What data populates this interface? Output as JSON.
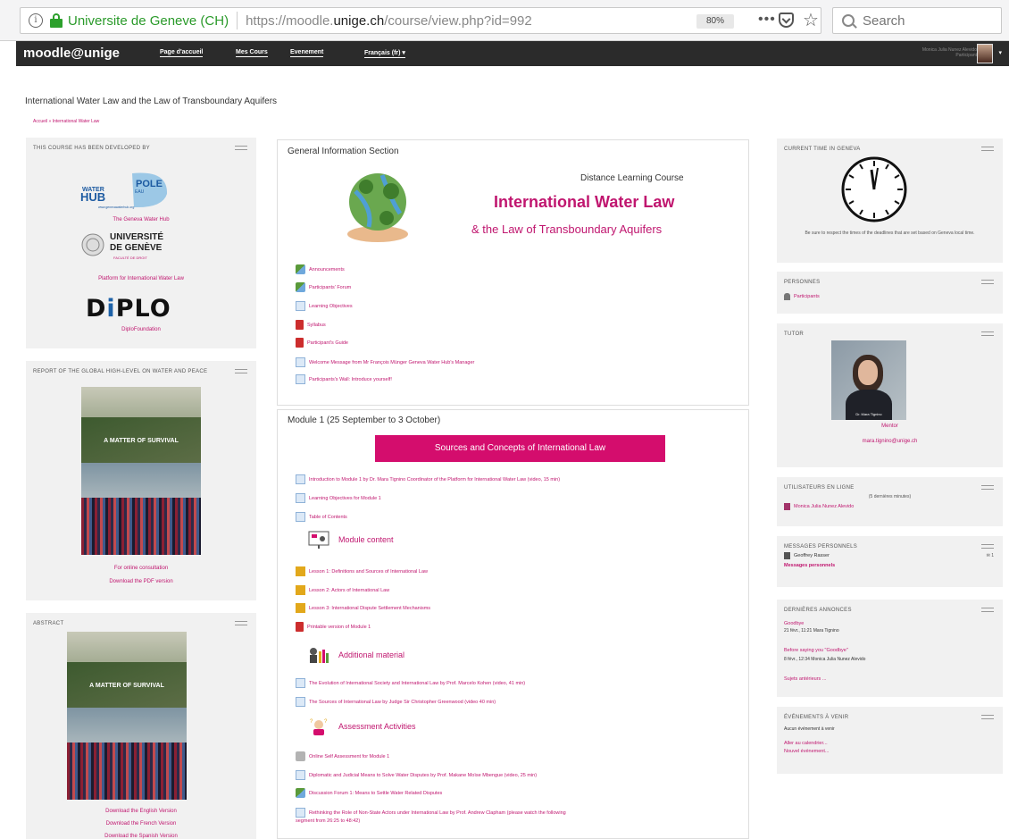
{
  "browser": {
    "site_identity": "Universite de Geneve (CH)",
    "url_prefix": "https://moodle.",
    "url_domain": "unige.ch",
    "url_path": "/course/view.php?id=992",
    "zoom": "80%",
    "search_placeholder": "Search"
  },
  "nav": {
    "brand": "moodle@unige",
    "items": [
      "Page d'accueil",
      "Mes Cours",
      "Evenement",
      "Français (fr) ▾"
    ],
    "user_name": "Monica Julia Nunez Alevido",
    "user_role": "Participant"
  },
  "page": {
    "title": "International Water Law and the Law of Transboundary Aquifers",
    "breadcrumb": "Accueil » International Water Law"
  },
  "left": {
    "developed": {
      "title": "THIS COURSE HAS BEEN DEVELOPED BY",
      "waterhub_label": "The Geneva Water Hub",
      "unige_name_1": "UNIVERSITÉ",
      "unige_name_2": "DE GENÈVE",
      "unige_faculty": "FACULTÉ DE DROIT",
      "platform_label": "Platform for International Water Law",
      "diplo_prefix": "D",
      "diplo_i": "i",
      "diplo_suffix": "PLO",
      "diplo_label": "DiploFoundation"
    },
    "report": {
      "title": "REPORT OF THE GLOBAL HIGH-LEVEL ON WATER AND PEACE",
      "cover_title": "A MATTER OF SURVIVAL",
      "link1": "For online consultation",
      "link2": "Download the PDF version"
    },
    "abstract": {
      "title": "ABSTRACT",
      "cover_title": "A MATTER OF SURVIVAL",
      "link1": "Download the English Version",
      "link2": "Download the French Version",
      "link3": "Download the Spanish Version"
    }
  },
  "general": {
    "title": "General Information Section",
    "dl_course": "Distance Learning Course",
    "iwl": "International Water Law",
    "iwl_sub": "& the Law of Transboundary Aquifers",
    "activities": [
      {
        "icon": "forum",
        "label": "Announcements"
      },
      {
        "icon": "forum",
        "label": "Participants' Forum"
      },
      {
        "icon": "page",
        "label": "Learning Objectives"
      },
      {
        "icon": "pdf",
        "label": "Syllabus"
      },
      {
        "icon": "pdf",
        "label": "Participant's Guide"
      },
      {
        "icon": "page",
        "label": "Welcome Message from Mr François Münger Geneva Water Hub's Manager"
      },
      {
        "icon": "page",
        "label": "Participants's Wall: Introduce yourself!"
      }
    ]
  },
  "module1": {
    "title": "Module 1 (25 September to 3 October)",
    "banner": "Sources and Concepts of International Law",
    "intro": [
      {
        "icon": "page",
        "label": "Introduction to Module 1 by Dr. Mara Tignino Coordinator of the Platform for International Water Law (video, 15 min)"
      },
      {
        "icon": "page",
        "label": "Learning Objectives for Module 1"
      },
      {
        "icon": "page",
        "label": "Table of Contents"
      }
    ],
    "content_head": "Module content",
    "content": [
      {
        "icon": "lesson",
        "label": "Lesson 1: Definitions and Sources of International Law"
      },
      {
        "icon": "lesson",
        "label": "Lesson 2: Actors of International Law"
      },
      {
        "icon": "lesson",
        "label": "Lesson 3: International Dispute Settlement Mechanisms"
      },
      {
        "icon": "pdf",
        "label": "Printable version of Module 1"
      }
    ],
    "additional_head": "Additional material",
    "additional": [
      {
        "icon": "page",
        "label": "The Evolution of International Society and International Law by Prof. Marcelo Kohen (video, 41 min)"
      },
      {
        "icon": "page",
        "label": "The Sources of International Law by Judge Sir Christopher Greenwood (video 40 min)"
      }
    ],
    "assessment_head": "Assessment Activities",
    "assessment": [
      {
        "icon": "check",
        "label": "Online Self Assessment for Module 1"
      },
      {
        "icon": "page",
        "label": "Diplomatic and Judicial Means to Solve Water Disputes by Prof. Makane Moïse Mbengue (video, 25 min)"
      },
      {
        "icon": "forum",
        "label": "Discussion Forum 1: Means to Settle Water Related Disputes"
      },
      {
        "icon": "page",
        "label": "Rethinking the Role of Non-State Actors under International Law by Prof. Andrew Clapham (please watch the following"
      },
      {
        "icon": "none",
        "label": "segment from 26:25 to 48:42)"
      }
    ]
  },
  "right": {
    "time": {
      "title": "CURRENT TIME IN GENEVA",
      "note": "Be sure to respect the times of the deadlines that are set based on Geneva local time."
    },
    "personnes": {
      "title": "PERSONNES",
      "link": "Participants"
    },
    "tutor": {
      "title": "TUTOR",
      "photo_caption": "Dr. Mara Tignino",
      "role": "Mentor",
      "email": "mara.tignino@unige.ch"
    },
    "online": {
      "title": "UTILISATEURS EN LIGNE",
      "sub": "(5 dernières minutes)",
      "user": "Monica Julia Nunez Alevido"
    },
    "messages": {
      "title": "MESSAGES PERSONNELS",
      "sender": "Geoffrey Rasser",
      "count": "1",
      "link": "Messages personnels"
    },
    "news": {
      "title": "DERNIÈRES ANNONCES",
      "item1_title": "Goodbye",
      "item1_meta": "21 févr., 11:21 Mara Tignino",
      "item2_title": "Before saying you \"Goodbye\"",
      "item2_meta": "8 févr., 12:34 Monica Julia Nunez Alevido",
      "older": "Sujets antérieurs ..."
    },
    "events": {
      "title": "ÉVÉNEMENTS À VENIR",
      "none": "Aucun événement à venir",
      "link1": "Aller au calendrier...",
      "link2": "Nouvel événement..."
    }
  }
}
